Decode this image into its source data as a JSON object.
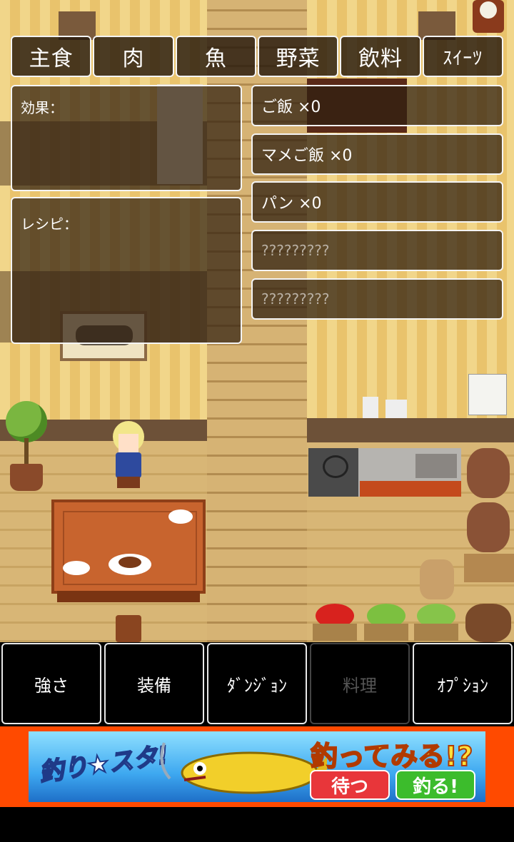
{
  "tabs": [
    "主食",
    "肉",
    "魚",
    "野菜",
    "飲料",
    "ｽｲｰﾂ"
  ],
  "effect_panel": {
    "label": "効果："
  },
  "recipe_panel": {
    "label": "レシピ："
  },
  "items": [
    {
      "label": "ご飯 ×0",
      "unlocked": true
    },
    {
      "label": "マメご飯 ×0",
      "unlocked": true
    },
    {
      "label": "パン ×0",
      "unlocked": true
    },
    {
      "label": "?????????",
      "unlocked": false
    },
    {
      "label": "?????????",
      "unlocked": false
    }
  ],
  "menu": [
    {
      "label": "強さ",
      "enabled": true
    },
    {
      "label": "装備",
      "enabled": true
    },
    {
      "label": "ﾀﾞﾝｼﾞｮﾝ",
      "enabled": true
    },
    {
      "label": "料理",
      "enabled": false
    },
    {
      "label": "ｵﾌﾟｼｮﾝ",
      "enabled": true
    }
  ],
  "ad": {
    "logo": "釣り★スタ!",
    "headline": "釣ってみる!?",
    "btn_wait": "待つ",
    "btn_fish": "釣る!",
    "colors": {
      "bg": "#ff4a00",
      "wait": "#e8363a",
      "fish": "#3cbc2c"
    }
  }
}
